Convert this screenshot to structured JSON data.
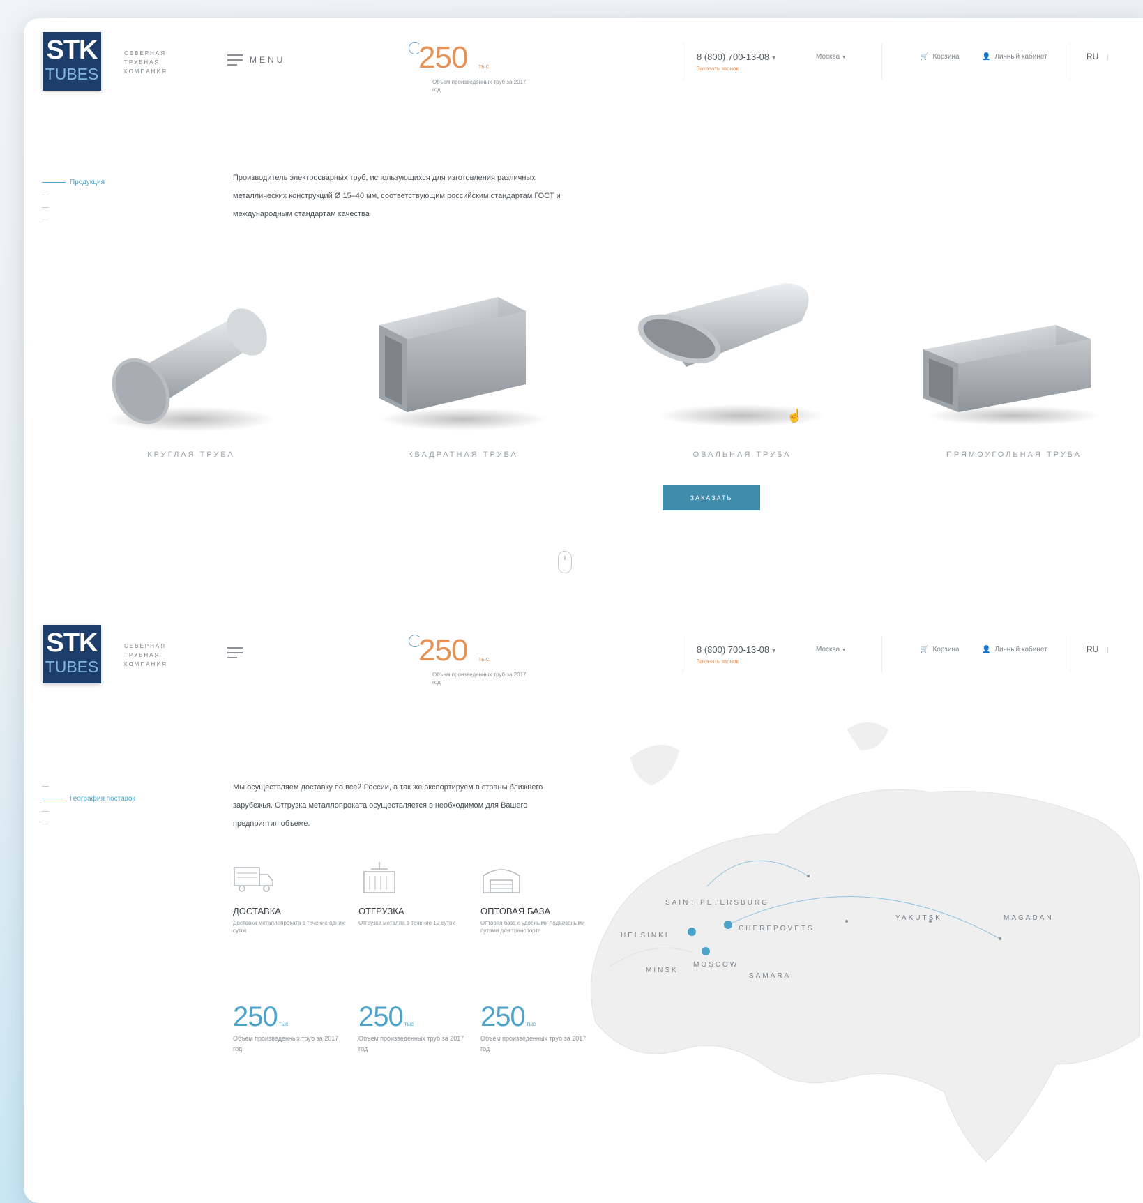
{
  "brand": {
    "logo_top": "STK",
    "logo_bottom": "TUBES",
    "tagline": "СЕВЕРНАЯ ТРУБНАЯ КОМПАНИЯ"
  },
  "header": {
    "menu_label": "MENU",
    "kpi_value": "250",
    "kpi_unit": "тыс.",
    "kpi_desc": "Объем произведенных труб за 2017 год",
    "phone": "8 (800) 700-13-08",
    "callback": "Заказать звонок",
    "city": "Москва",
    "cart": "Корзина",
    "account": "Личный кабинет",
    "lang": "RU"
  },
  "section1": {
    "side_active": "Продукция",
    "intro": "Производитель электросварных труб, использующихся для изготовления различных металлических конструкций Ø 15–40 мм, соответствующим российским стандартам ГОСТ и международным стандартам качества",
    "products": [
      {
        "label": "КРУГЛАЯ ТРУБА"
      },
      {
        "label": "КВАДРАТНАЯ ТРУБА"
      },
      {
        "label": "ОВАЛЬНАЯ ТРУБА"
      },
      {
        "label": "ПРЯМОУГОЛЬНАЯ ТРУБА"
      }
    ],
    "order_button": "ЗАКАЗАТЬ"
  },
  "section2": {
    "side_active": "География поставок",
    "intro": "Мы осуществляем доставку по всей России, а так же экспортируем в страны ближнего зарубежья. Отгрузка металлопроката осуществляется в необходимом для Вашего предприятия объеме.",
    "features": [
      {
        "title": "ДОСТАВКА",
        "desc": "Доставка металлопроката в течение одних суток",
        "icon": "truck-icon"
      },
      {
        "title": "ОТГРУЗКА",
        "desc": "Отгрузка металла в течение 12 суток",
        "icon": "container-icon"
      },
      {
        "title": "ОПТОВАЯ БАЗА",
        "desc": "Оптовая база с удобными подъездными путями для транспорта",
        "icon": "warehouse-icon"
      }
    ],
    "stats": [
      {
        "value": "250",
        "unit": "тыс",
        "desc": "Объем произведенных труб за 2017 год"
      },
      {
        "value": "250",
        "unit": "тыс",
        "desc": "Объем произведенных труб за 2017 год"
      },
      {
        "value": "250",
        "unit": "тыс",
        "desc": "Объем произведенных труб за 2017 год"
      }
    ],
    "map_cities": {
      "saint_petersburg": "SAINT PETERSBURG",
      "helsinki": "HELSINKI",
      "cherepovets": "CHEREPOVETS",
      "minsk": "MINSK",
      "moscow": "MOSCOW",
      "samara": "SAMARA",
      "yakutsk": "YAKUTSK",
      "magadan": "MAGADAN"
    }
  },
  "colors": {
    "brand_navy": "#1d3e6b",
    "accent_orange": "#e39358",
    "accent_blue": "#4ea3c9",
    "button_blue": "#3f8cad"
  }
}
